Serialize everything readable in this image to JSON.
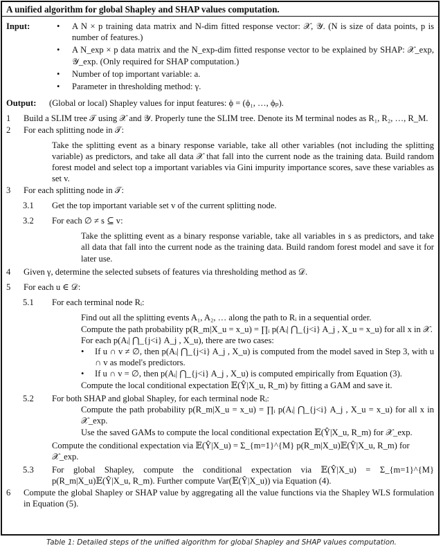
{
  "title": "A unified algorithm for global Shapley and SHAP values computation.",
  "input": {
    "label": "Input:",
    "items": [
      "A N × p training data matrix and N-dim fitted response vector: 𝒳, 𝒴. (N is size of data points, p is number of features.)",
      "A N_exp × p data matrix and the N_exp-dim fitted response vector to be explained by SHAP: 𝒳_exp, 𝒴_exp. (Only required for SHAP computation.)",
      "Number of top important variable: a.",
      "Parameter in thresholding method: γ."
    ]
  },
  "output": {
    "label": "Output:",
    "text": "(Global or local) Shapley values for input features: ϕ = (ϕ₁, …, ϕₚ)."
  },
  "steps": {
    "s1": {
      "num": "1",
      "text": "Build a SLIM tree 𝒯 using 𝒳 and 𝒴. Properly tune the SLIM tree. Denote its M terminal nodes as R₁, R₂, …, R_M."
    },
    "s2": {
      "num": "2",
      "text": "For each splitting node in 𝒯:",
      "detail": "Take the splitting event as a binary response variable, take all other variables (not including the splitting variable) as predictors, and take all data 𝒳 that fall into the current node as the training data. Build random forest model and select top a important variables via Gini impurity importance scores, save these variables as set v."
    },
    "s3": {
      "num": "3",
      "text": "For each splitting node in 𝒯:",
      "s31": {
        "num": "3.1",
        "text": "Get the top important variable set v of the current splitting node."
      },
      "s32": {
        "num": "3.2",
        "text": "For each ∅ ≠ s ⊆ v:",
        "detail": "Take the splitting event as a binary response variable, take all variables in s as predictors, and take all data that fall into the current node as the training data. Build random forest model and save it for later use."
      }
    },
    "s4": {
      "num": "4",
      "text": "Given γ, determine the selected subsets of features via thresholding method as 𝒟."
    },
    "s5": {
      "num": "5",
      "text": "For each u ∈ 𝒟:",
      "s51": {
        "num": "5.1",
        "text": "For each terminal node Rᵢ:",
        "line1": "Find out all the splitting events A₁, A₂, …  along the path to Rᵢ in a sequential order.",
        "line2": "Compute the path probability p(R_m|X_u = x_u) = ∏ᵢ p(Aᵢ| ⋂_{j<i} A_j , X_u = x_u) for all x in 𝒳.",
        "line3": "For each p(Aᵢ| ⋂_{j<i} A_j , X_u), there are two cases:",
        "case1": "If u ∩ v ≠ ∅, then p(Aᵢ| ⋂_{j<i} A_j , X_u) is computed from the model saved in Step 3, with u ∩ v as model's predictors.",
        "case2": "If u ∩ v = ∅, then p(Aᵢ| ⋂_{j<i} A_j , X_u) is computed empirically from Equation (3).",
        "line4": "Compute the local conditional expectation 𝔼(Ŷ|X_u, R_m) by fitting a GAM and save it."
      },
      "s52": {
        "num": "5.2",
        "text": "For both SHAP and global Shapley, for each terminal node Rᵢ:",
        "line1": "Compute the path probability p(R_m|X_u = x_u) = ∏ᵢ p(Aᵢ| ⋂_{j<i} A_j , X_u = x_u) for all x in 𝒳_exp.",
        "line2": "Use the saved GAMs to compute the local conditional expectation 𝔼(Ŷ|X_u, R_m) for 𝒳_exp.",
        "line3": "Compute the conditional expectation via 𝔼(Ŷ|X_u) = Σ_{m=1}^{M} p(R_m|X_u)𝔼(Ŷ|X_u, R_m) for 𝒳_exp."
      },
      "s53": {
        "num": "5.3",
        "text": "For global Shapley, compute the conditional expectation via 𝔼(Ŷ|X_u) = Σ_{m=1}^{M} p(R_m|X_u)𝔼(Ŷ|X_u, R_m). Further compute Var(𝔼(Ŷ|X_u)) via Equation (4)."
      }
    },
    "s6": {
      "num": "6",
      "text": "Compute the global Shapley or SHAP value by aggregating all the value functions via the Shapley WLS formulation in Equation (5)."
    }
  },
  "caption": "Table 1: Detailed steps of the unified algorithm for global Shapley and SHAP values computation."
}
